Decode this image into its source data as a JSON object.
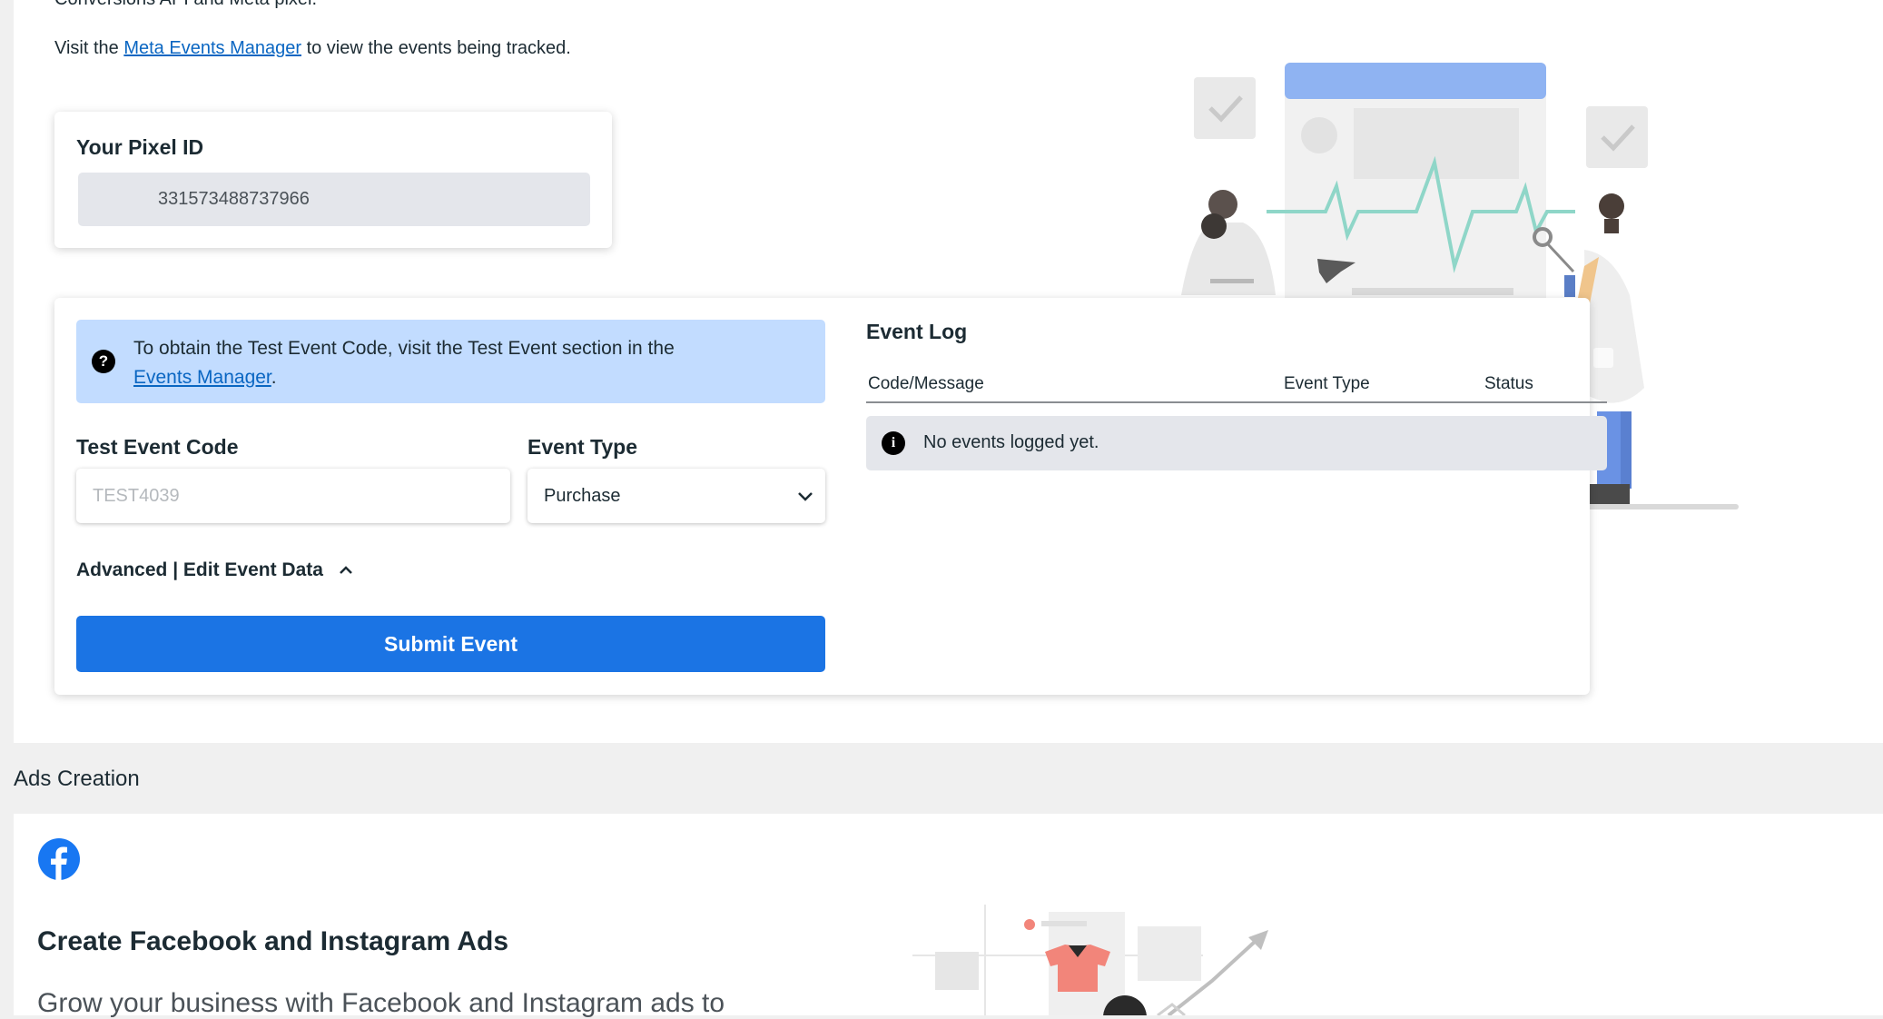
{
  "intro": {
    "partial_line": "Conversions API and Meta pixel.",
    "visit_prefix": "Visit the",
    "visit_link": "Meta Events Manager",
    "visit_suffix": "to view the events being tracked."
  },
  "pixel": {
    "title": "Your Pixel ID",
    "value": "331573488737966"
  },
  "test_events": {
    "info_prefix": "To obtain the Test Event Code, visit the Test Event section in the",
    "info_link": "Events Manager",
    "info_suffix": ".",
    "code_label": "Test Event Code",
    "code_placeholder": "TEST4039",
    "type_label": "Event Type",
    "type_selected": "Purchase",
    "advanced_label": "Advanced | Edit Event Data",
    "submit_label": "Submit Event"
  },
  "event_log": {
    "title": "Event Log",
    "columns": [
      "Code/Message",
      "Event Type",
      "Status"
    ],
    "empty_message": "No events logged yet."
  },
  "ads": {
    "section_title": "Ads Creation",
    "title": "Create Facebook and Instagram Ads",
    "description": "Grow your business with Facebook and Instagram ads to"
  },
  "colors": {
    "primary_button": "#1b74e4",
    "info_box": "#c2dcff",
    "link": "#0a66c2",
    "facebook_brand": "#1877f2"
  }
}
